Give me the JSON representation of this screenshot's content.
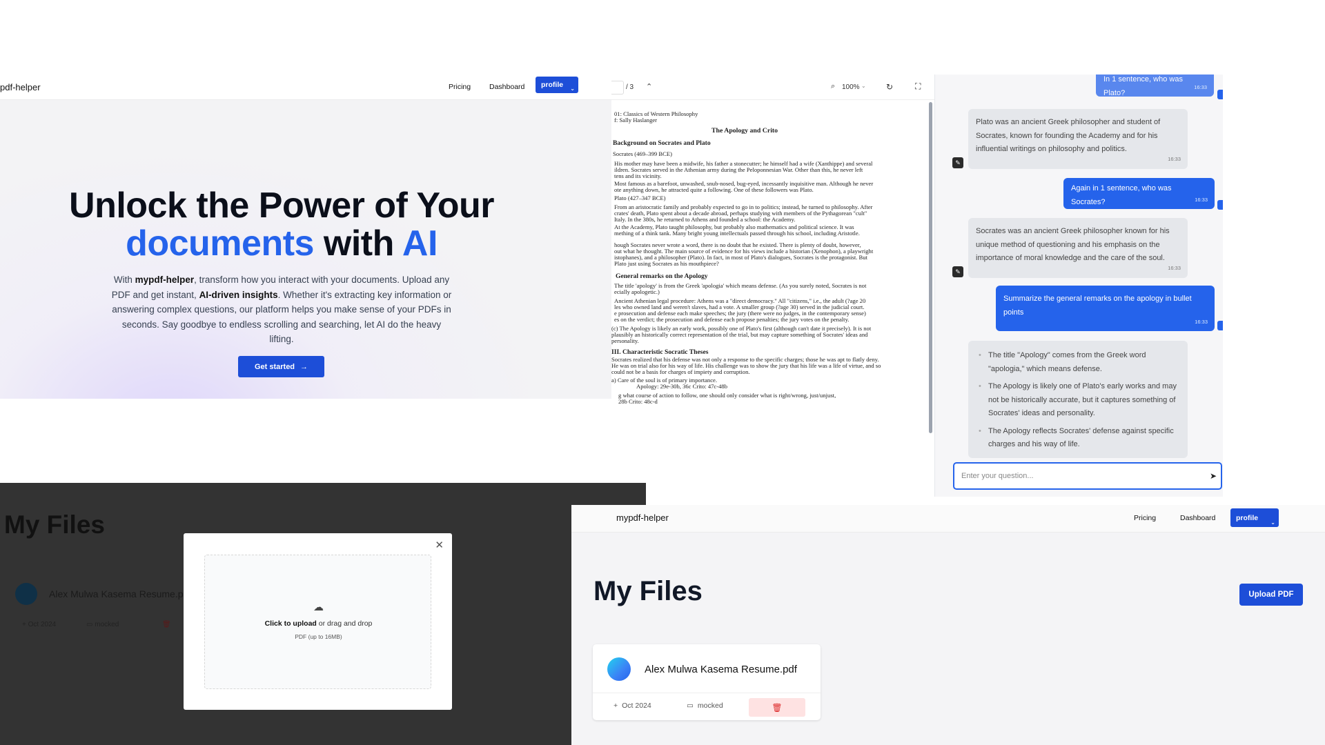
{
  "landing": {
    "brand": "pdf-helper",
    "nav": {
      "pricing": "Pricing",
      "dashboard": "Dashboard",
      "profile": "profile"
    },
    "hero": {
      "line1": "Unlock the Power of Your",
      "word_documents": "documents",
      "word_with": "with",
      "word_ai": "AI",
      "desc_1": "With ",
      "desc_brand": "mypdf-helper",
      "desc_2": ", transform how you interact with your documents. Upload any PDF and get instant, ",
      "desc_bold": "AI-driven insights",
      "desc_3": ". Whether it's extracting key information or answering complex questions, our platform helps you make sense of your PDFs in seconds. Say goodbye to endless scrolling and searching, let AI do the heavy lifting.",
      "cta": "Get started"
    }
  },
  "viewer": {
    "page_total": "/ 3",
    "zoom": "100%",
    "lines": [
      "01: Classics of Western Philosophy",
      "f: Sally Haslanger",
      "The Apology and Crito",
      "Background on Socrates and Plato",
      "Socrates (469–399 BCE)",
      "His mother may have been a midwife, his father a stonecutter; he himself had a wife (Xanthippe) and several",
      "ildren. Socrates served in the Athenian army during the Peloponnesian War. Other than this, he never left",
      "tens and its vicinity.",
      "Most famous as a barefoot, unwashed, snub-nosed, bug-eyed, incessantly inquisitive man. Although he never",
      "ote anything down, he attracted quite a following. One of these followers was Plato.",
      "Plato (427–347 BCE)",
      "From an aristocratic family and probably expected to go in to politics; instead, he turned to philosophy. After",
      "crates' death, Plato spent about a decade abroad, perhaps studying with members of the Pythagorean \"cult\"",
      "Italy. In the 380s, he returned to Athens and founded a school: the Academy.",
      "At the Academy, Plato taught philosophy, but probably also mathematics and political science. It was",
      "mething of a think tank. Many bright young intellectuals passed through his school, including Aristotle.",
      "hough Socrates never wrote a word, there is no doubt that he existed. There is plenty of doubt, however,",
      "out what he thought. The main source of evidence for his views include a historian (Xenophon), a playwright",
      "istophanes), and a philosopher (Plato). In fact, in most of Plato's dialogues, Socrates is the protagonist. But",
      "Plato just using Socrates as his mouthpiece?",
      "General remarks on the Apology",
      "The title 'apology' is from the Greek 'apologia' which means defense. (As you surely noted, Socrates is not",
      "ecially apologetic.)",
      "Ancient Athenian legal procedure: Athens was a \"direct democracy.\" All \"citizens,\" i.e., the adult (?age 20",
      "les who owned land and weren't slaves, had a vote. A smaller group (?age 30) served in the judicial court.",
      "e prosecution and defense each make speeches; the jury (there were no judges, in the contemporary sense)",
      "es on the verdict; the prosecution and defense each propose penalties; the jury votes on the penalty.",
      "(c) The Apology is likely an early work, possibly one of Plato's first (although can't date it precisely). It is not",
      "plausibly an historically correct representation of the trial, but may capture something of Socrates' ideas and",
      "personality.",
      "III. Characteristic Socratic Theses",
      "Socrates realized that his defense was not only a response to the specific charges; those he was apt to flatly deny.",
      "He was on trial also for his way of life. His challenge was to show the jury that his life was a life of virtue, and so",
      "could not be a basis for charges of impiety and corruption.",
      "a) Care of the soul is of primary importance.",
      "Apology: 29e-30b, 36c     Crito: 47c-48b",
      "g what course of action to follow, one should only consider what is right/wrong, just/unjust,",
      "28b                                   Crito: 48c-d"
    ]
  },
  "chat": {
    "messages": [
      {
        "role": "user",
        "text": "In 1 sentence, who was Plato?",
        "time": "16:33"
      },
      {
        "role": "ai",
        "text": "Plato was an ancient Greek philosopher and student of Socrates, known for founding the Academy and for his influential writings on philosophy and politics.",
        "time": "16:33"
      },
      {
        "role": "user",
        "text": "Again in 1 sentence, who was Socrates?",
        "time": "16:33"
      },
      {
        "role": "ai",
        "text": "Socrates was an ancient Greek philosopher known for his unique method of questioning and his emphasis on the importance of moral knowledge and the care of the soul.",
        "time": "16:33"
      },
      {
        "role": "user",
        "text": "Summarize the general remarks on the apology in bullet points",
        "time": "16:33"
      }
    ],
    "bullets": [
      "The title \"Apology\" comes from the Greek word \"apologia,\" which means defense.",
      "The Apology is likely one of Plato's early works and may not be historically accurate, but it captures something of Socrates' ideas and personality.",
      "The Apology reflects Socrates' defense against specific charges and his way of life."
    ],
    "input_placeholder": "Enter your question..."
  },
  "files_dark": {
    "title": "My Files",
    "file_name": "Alex Mulwa Kasema Resume.pdf",
    "date": "Oct 2024",
    "status": "mocked",
    "modal": {
      "click_text": "Click to upload",
      "drag_text": " or drag and drop",
      "limit": "PDF (up to 16MB)"
    }
  },
  "files_light": {
    "brand": "mypdf-helper",
    "nav": {
      "pricing": "Pricing",
      "dashboard": "Dashboard",
      "profile": "profile"
    },
    "title": "My Files",
    "upload_btn": "Upload PDF",
    "file_name": "Alex Mulwa Kasema Resume.pdf",
    "date": "Oct 2024",
    "status": "mocked"
  },
  "colors": {
    "accent": "#1d4ed8",
    "user_bubble": "#2563eb",
    "ai_bubble": "#e5e7eb",
    "danger": "#dc2626"
  }
}
